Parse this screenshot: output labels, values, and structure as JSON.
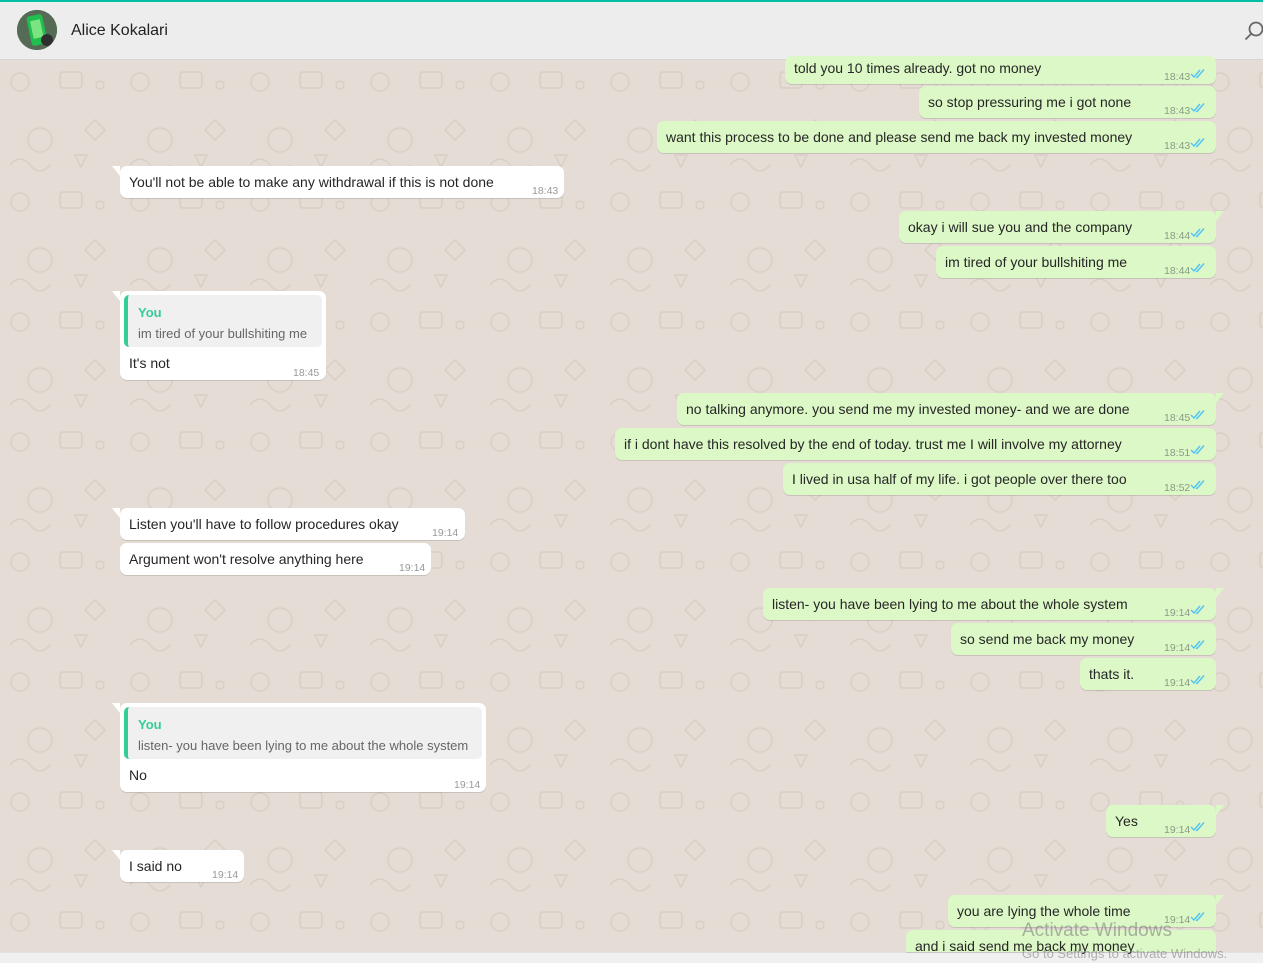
{
  "header": {
    "contact_name": "Alice Kokalari"
  },
  "messages": [
    {
      "dir": "out",
      "text": "told you 10 times already. got no money",
      "time": "18:43"
    },
    {
      "dir": "out",
      "text": "so stop pressuring me i got none",
      "time": "18:43"
    },
    {
      "dir": "out",
      "text": "want this process to be done and please send me back my invested money",
      "time": "18:43"
    },
    {
      "dir": "in",
      "text": "You'll not be able to make any withdrawal if this is not done",
      "time": "18:43"
    },
    {
      "dir": "out",
      "text": "okay i will sue you and the company",
      "time": "18:44"
    },
    {
      "dir": "out",
      "text": "im tired of your bullshiting me",
      "time": "18:44"
    },
    {
      "dir": "in",
      "quote_author": "You",
      "quote_text": "im tired of your bullshiting me",
      "text": "It's not",
      "time": "18:45"
    },
    {
      "dir": "out",
      "text": "no talking anymore. you send me my invested money- and we are done",
      "time": "18:45"
    },
    {
      "dir": "out",
      "text": "if i dont have this resolved by the end of today. trust me I will involve my attorney",
      "time": "18:51"
    },
    {
      "dir": "out",
      "text": "I lived in usa half of my life. i got people over there too",
      "time": "18:52"
    },
    {
      "dir": "in",
      "text": "Listen you'll have to follow procedures okay",
      "time": "19:14"
    },
    {
      "dir": "in",
      "text": "Argument won't resolve anything here",
      "time": "19:14"
    },
    {
      "dir": "out",
      "text": "listen- you have been lying to me about the whole system",
      "time": "19:14"
    },
    {
      "dir": "out",
      "text": "so send me back my money",
      "time": "19:14"
    },
    {
      "dir": "out",
      "text": "thats it.",
      "time": "19:14"
    },
    {
      "dir": "in",
      "quote_author": "You",
      "quote_text": "listen- you have been lying to me about the whole system",
      "text": "No",
      "time": "19:14"
    },
    {
      "dir": "out",
      "text": "Yes",
      "time": "19:14"
    },
    {
      "dir": "in",
      "text": "I said no",
      "time": "19:14"
    },
    {
      "dir": "out",
      "text": "you are lying the whole time",
      "time": "19:14"
    },
    {
      "dir": "out",
      "text": "and i said send me back my money",
      "time": ""
    }
  ],
  "watermark": {
    "line1": "Activate Windows",
    "line2": "Go to Settings to activate Windows."
  },
  "colors": {
    "outgoing_bubble": "#dcf8c6",
    "incoming_bubble": "#ffffff",
    "chat_background": "#e5ddd5",
    "read_ticks": "#4fc3f7",
    "quote_accent": "#35cd96"
  },
  "icons": {
    "header_left": "contact-avatar",
    "header_right": "search-icon",
    "read_receipt": "double-check-icon"
  }
}
